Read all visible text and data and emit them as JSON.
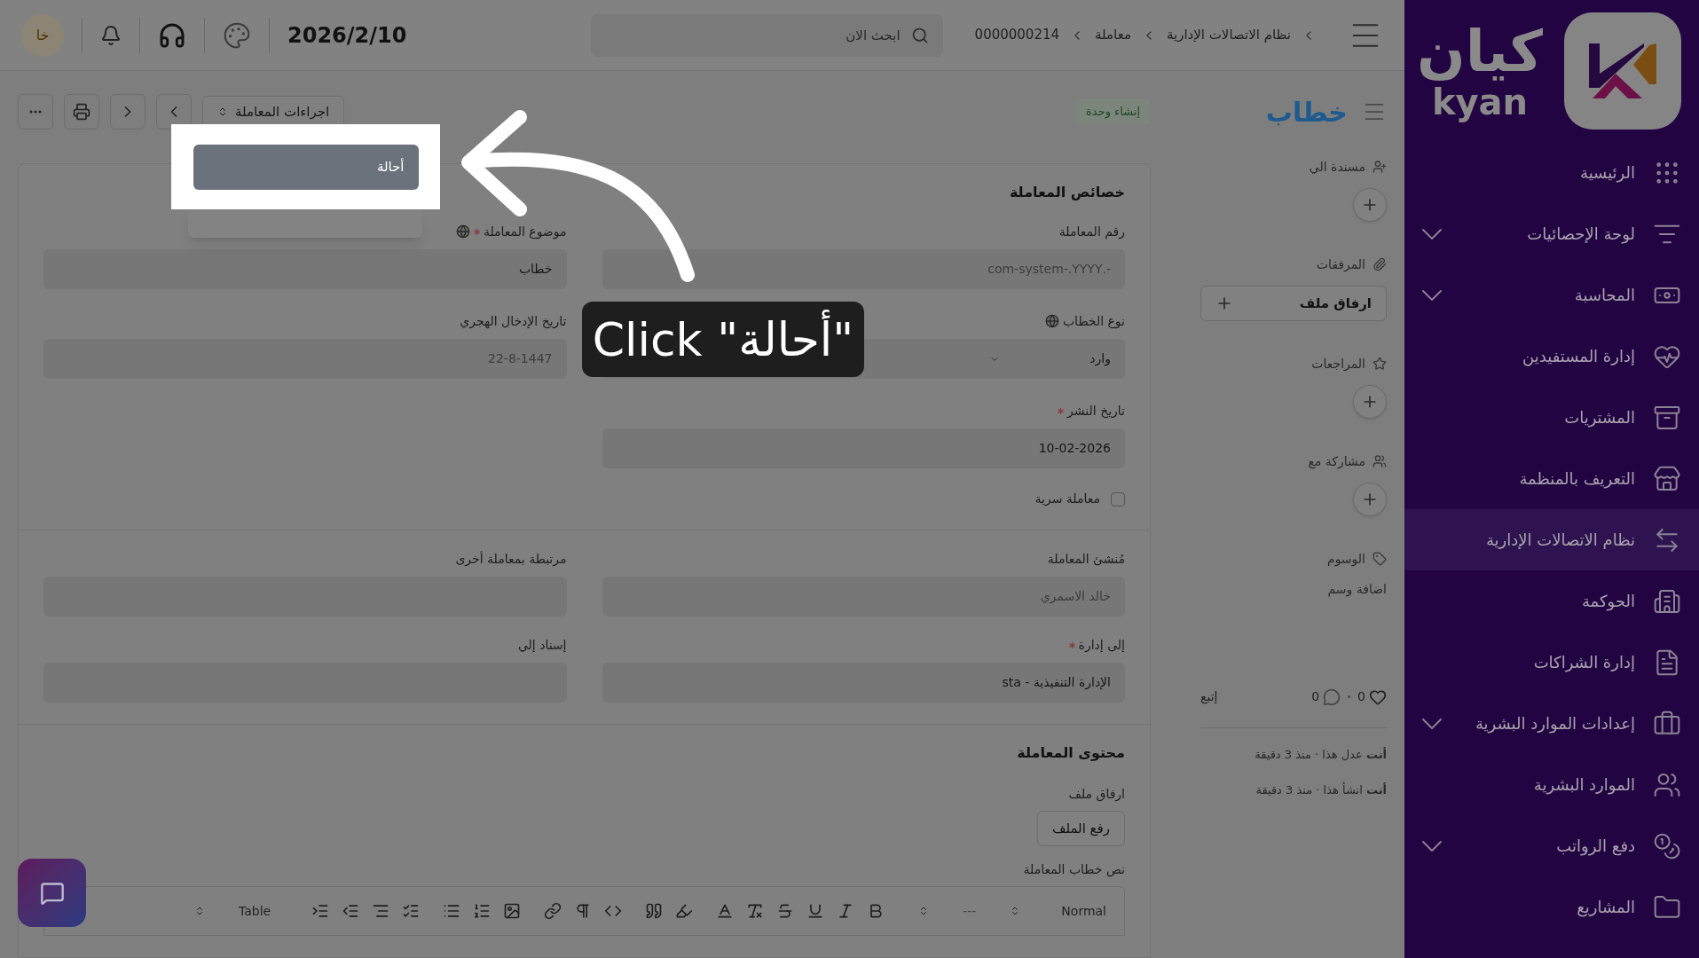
{
  "topbar": {
    "breadcrumb": [
      "نظام الاتصالات الإدارية",
      "معاملة",
      "0000000214"
    ],
    "search": {
      "placeholder": "ابحث الان"
    },
    "date": "2026/2/10",
    "avatar": "خا"
  },
  "sidebar": {
    "logo": {
      "arabic": "كيان",
      "latin": "kyan"
    },
    "items": [
      {
        "label": "الرئيسية",
        "selected": false,
        "expandable": false
      },
      {
        "label": "لوحة الإحصائيات",
        "selected": false,
        "expandable": true
      },
      {
        "label": "المحاسبة",
        "selected": false,
        "expandable": true
      },
      {
        "label": "إدارة المستفيدين",
        "selected": false,
        "expandable": false
      },
      {
        "label": "المشتريات",
        "selected": false,
        "expandable": false
      },
      {
        "label": "التعريف بالمنظمة",
        "selected": false,
        "expandable": false
      },
      {
        "label": "نظام الاتصالات الإدارية",
        "selected": true,
        "expandable": false
      },
      {
        "label": "الحوكمة",
        "selected": false,
        "expandable": false
      },
      {
        "label": "إدارة الشراكات",
        "selected": false,
        "expandable": false
      },
      {
        "label": "إعدادات الموارد البشرية",
        "selected": false,
        "expandable": true
      },
      {
        "label": "الموارد البشرية",
        "selected": false,
        "expandable": false
      },
      {
        "label": "دفع الرواتب",
        "selected": false,
        "expandable": true
      },
      {
        "label": "المشاريع",
        "selected": false,
        "expandable": false
      }
    ]
  },
  "header": {
    "title": "خطاب",
    "status": "إنشاء وحدة",
    "actions_label": "اجراءات المعاملة"
  },
  "action_menu": {
    "items": [
      {
        "label": "أحالة",
        "selected": true
      }
    ]
  },
  "side_panel": {
    "assigned_to": "مسندة الي",
    "attachments": "المرفقات",
    "attach_button": "ارفاق ملف",
    "reviews": "المراجعات",
    "shared_with": "مشاركة مع",
    "tags": "الوسوم",
    "add_tag": "اضافة وسم",
    "likes": "0",
    "comments": "0",
    "follow": "إتبع",
    "activity": [
      "**أنت** عدل هذا · منذ 3 دقيقة",
      "**أنت** انشأ هذا · منذ 3 دقيقة"
    ]
  },
  "properties": {
    "title": "خصائص المعاملة",
    "number": {
      "label": "رقم المعاملة",
      "value": "-.com-system-.YYYY"
    },
    "letter_type": {
      "label": "نوع الخطاب",
      "value": "وارد"
    },
    "publish_date": {
      "label": "تاريخ النشر",
      "required": true,
      "value": "10-02-2026"
    },
    "confidential": {
      "label": "معاملة سرية",
      "checked": false
    },
    "subject": {
      "label": "موضوع المعاملة",
      "required": true,
      "value": "خطاب"
    },
    "hijri_date": {
      "label": "تاريخ الإدخال الهجري",
      "value": "22-8-1447"
    }
  },
  "assignment": {
    "creator": {
      "label": "مُنشئ المعاملة",
      "value": "خالد الاسمري"
    },
    "linked": {
      "label": "مرتبطة بمعاملة أخرى"
    },
    "department": {
      "label": "إلى إدارة",
      "required": true,
      "value": "الإدارة التنفيذية - sta"
    },
    "assign_to": {
      "label": "إسناد إلي"
    }
  },
  "content": {
    "title": "محتوى المعاملة",
    "attach_label": "ارفاق ملف",
    "upload_button": "رفع الملف",
    "body_label": "نص خطاب المعاملة",
    "editor": {
      "style": "Normal",
      "divider": "---",
      "table": "Table"
    }
  },
  "tooltip": {
    "text": "Click \"أحالة\""
  }
}
